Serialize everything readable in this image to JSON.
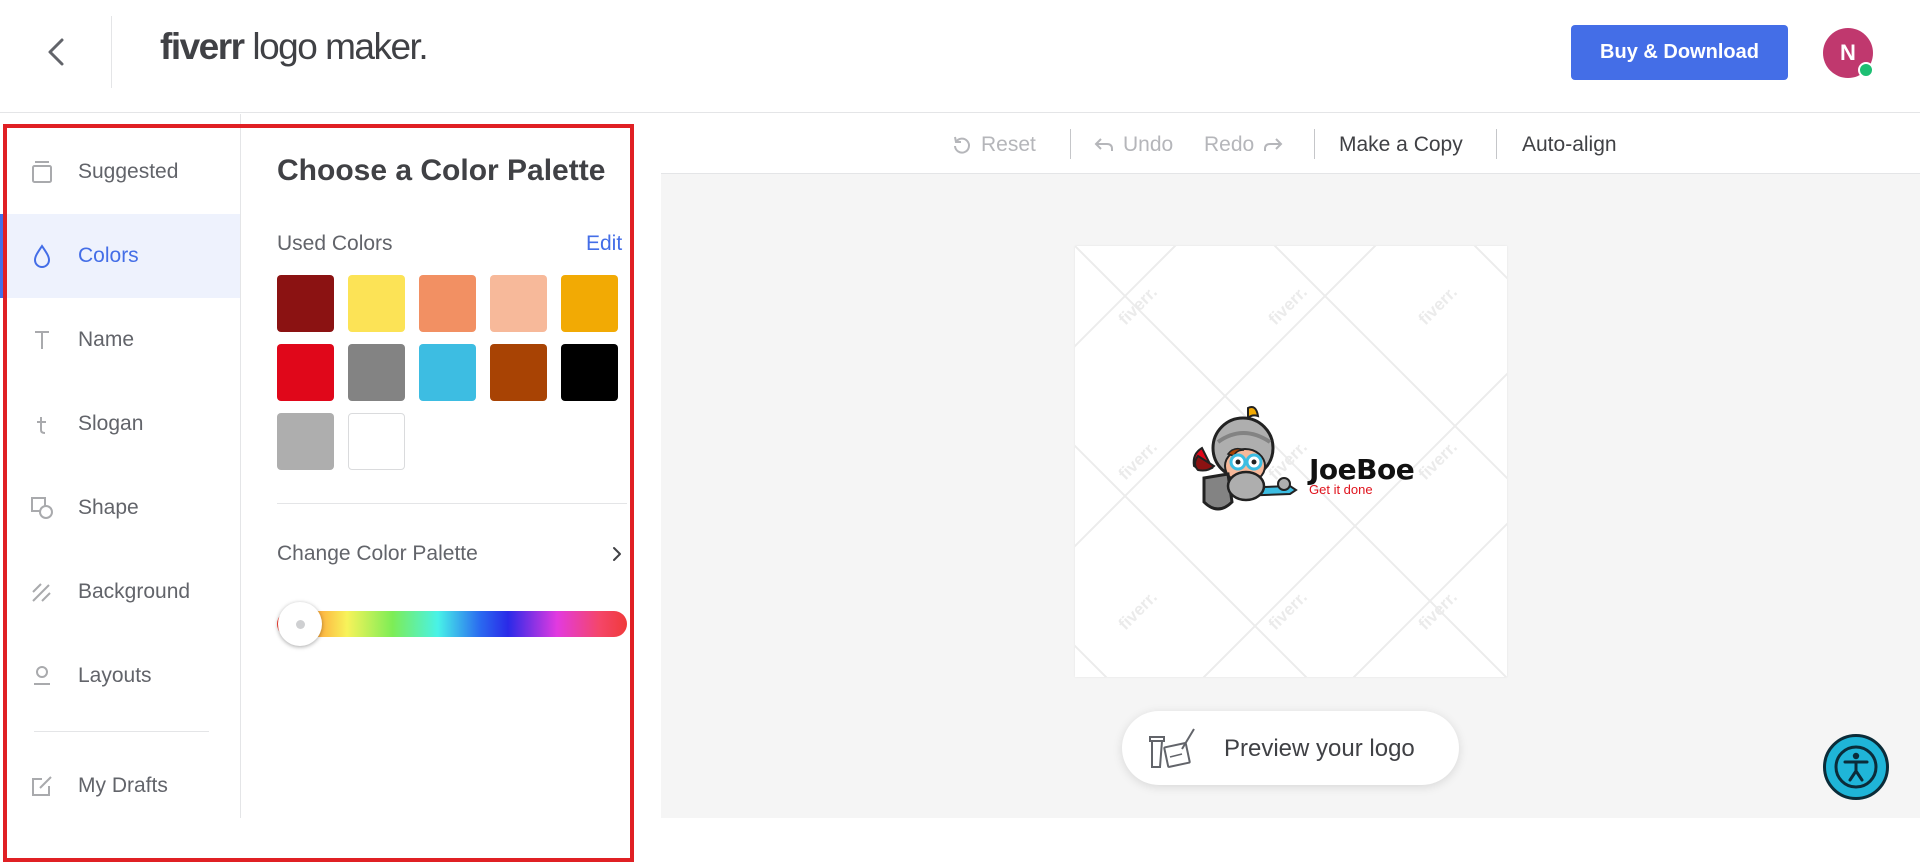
{
  "header": {
    "brand_part1": "fiverr",
    "brand_part2": " logo maker.",
    "buy_label": "Buy & Download",
    "avatar_initial": "N"
  },
  "nav": {
    "items": [
      {
        "label": "Suggested",
        "icon": "suggested-icon"
      },
      {
        "label": "Colors",
        "icon": "drop-icon",
        "active": true
      },
      {
        "label": "Name",
        "icon": "text-t-icon"
      },
      {
        "label": "Slogan",
        "icon": "small-t-icon"
      },
      {
        "label": "Shape",
        "icon": "shape-icon"
      },
      {
        "label": "Background",
        "icon": "background-icon"
      },
      {
        "label": "Layouts",
        "icon": "layouts-icon"
      },
      {
        "label": "My Drafts",
        "icon": "drafts-icon"
      }
    ]
  },
  "panel": {
    "title": "Choose a Color Palette",
    "used_colors_label": "Used Colors",
    "edit_label": "Edit",
    "used_colors": [
      "#8b1212",
      "#fce356",
      "#f29063",
      "#f7b99a",
      "#f2aa04",
      "#e0071a",
      "#838383",
      "#3dbde2",
      "#a84304",
      "#000000",
      "#aeaeae",
      "#ffffff"
    ],
    "change_palette_label": "Change Color Palette",
    "hue_position": 0
  },
  "toolbar": {
    "reset": "Reset",
    "undo": "Undo",
    "redo": "Redo",
    "make_copy": "Make a Copy",
    "auto_align": "Auto-align"
  },
  "canvas": {
    "watermark": "fiverr.",
    "logo_name": "JoeBoe",
    "logo_slogan": "Get it done",
    "preview_label": "Preview your logo"
  },
  "colors": {
    "accent": "#446ee7",
    "avatar": "#c0386e",
    "online": "#1dbf73",
    "highlight": "#e02024",
    "accessibility": "#1fb5d8"
  }
}
